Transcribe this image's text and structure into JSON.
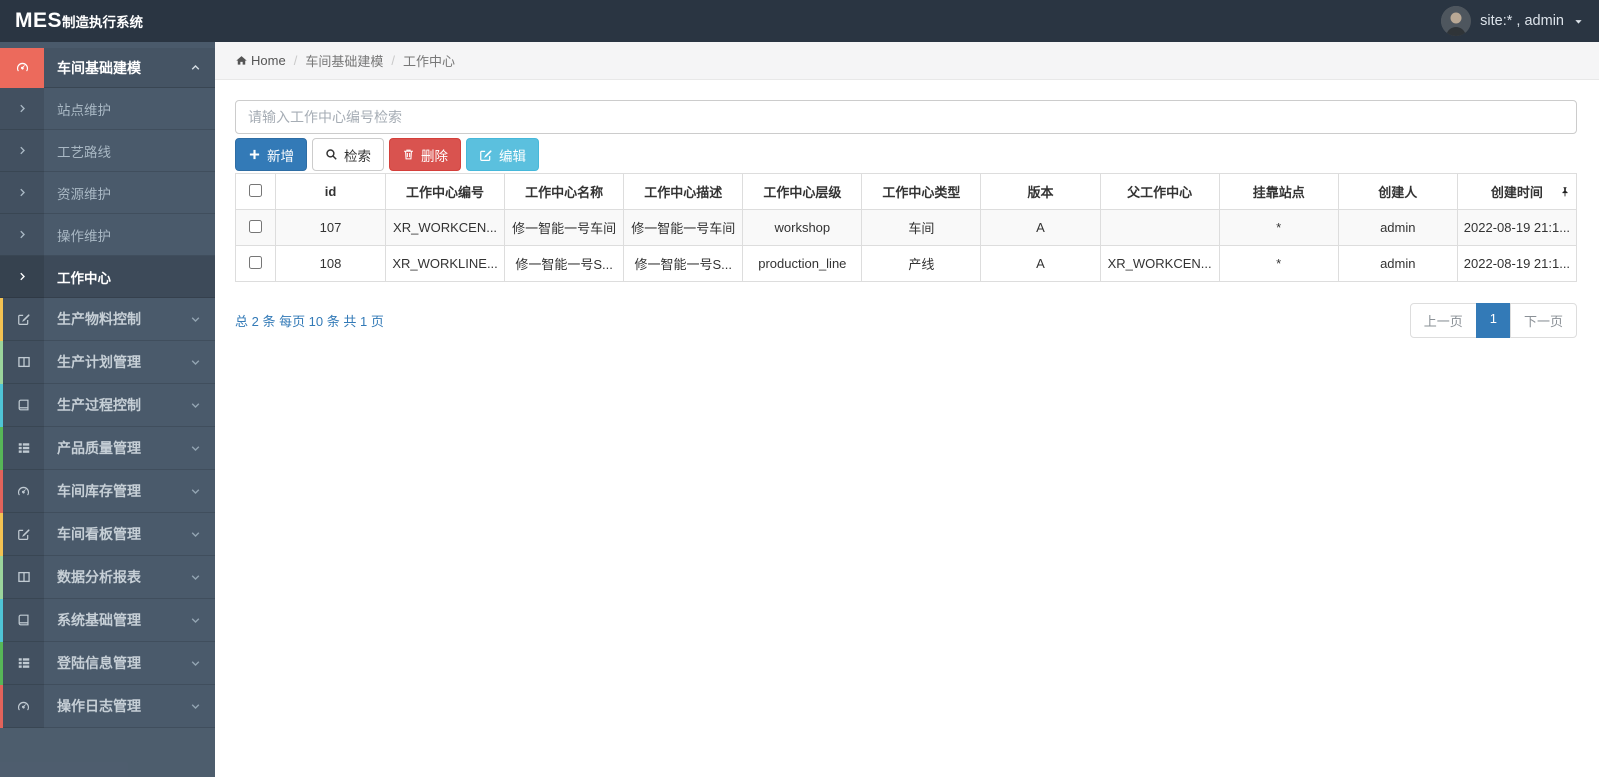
{
  "app": {
    "logo_bold": "MES",
    "logo_suffix": "制造执行系统",
    "user_label": "site:* , admin"
  },
  "breadcrumb": {
    "home": "Home",
    "items": [
      "车间基础建模",
      "工作中心"
    ]
  },
  "sidebar": {
    "active_group": {
      "label": "车间基础建模",
      "icon": "tachometer-icon",
      "accent": "#ec6a5c"
    },
    "submenu": {
      "items": [
        "站点维护",
        "工艺路线",
        "资源维护",
        "操作维护",
        "工作中心"
      ],
      "active_index": 4
    },
    "groups": [
      {
        "label": "生产物料控制",
        "icon": "edit-icon",
        "accent": "#f3c252"
      },
      {
        "label": "生产计划管理",
        "icon": "columns-icon",
        "accent": "#9bd49b"
      },
      {
        "label": "生产过程控制",
        "icon": "book-icon",
        "accent": "#4fc4d6"
      },
      {
        "label": "产品质量管理",
        "icon": "th-list-icon",
        "accent": "#57b657"
      },
      {
        "label": "车间库存管理",
        "icon": "tachometer-icon",
        "accent": "#e2635b"
      },
      {
        "label": "车间看板管理",
        "icon": "edit-icon",
        "accent": "#f3c252"
      },
      {
        "label": "数据分析报表",
        "icon": "columns-icon",
        "accent": "#9bd49b"
      },
      {
        "label": "系统基础管理",
        "icon": "book-icon",
        "accent": "#4fc4d6"
      },
      {
        "label": "登陆信息管理",
        "icon": "th-list-icon",
        "accent": "#57b657"
      },
      {
        "label": "操作日志管理",
        "icon": "tachometer-icon",
        "accent": "#e2635b"
      }
    ]
  },
  "toolbar": {
    "search_placeholder": "请输入工作中心编号检索",
    "buttons": [
      {
        "label": "新增",
        "style": "primary",
        "icon": "plus-icon"
      },
      {
        "label": "检索",
        "style": "default",
        "icon": "search-icon"
      },
      {
        "label": "删除",
        "style": "danger",
        "icon": "trash-icon"
      },
      {
        "label": "编辑",
        "style": "info",
        "icon": "edit-icon"
      }
    ]
  },
  "table": {
    "headers": [
      "id",
      "工作中心编号",
      "工作中心名称",
      "工作中心描述",
      "工作中心层级",
      "工作中心类型",
      "版本",
      "父工作中心",
      "挂靠站点",
      "创建人",
      "创建时间"
    ],
    "rows": [
      {
        "selected": false,
        "striped": true,
        "cells": [
          "107",
          "XR_WORKCEN...",
          "修一智能一号车间",
          "修一智能一号车间",
          "workshop",
          "车间",
          "A",
          "",
          "*",
          "admin",
          "2022-08-19 21:1..."
        ]
      },
      {
        "selected": false,
        "striped": false,
        "cells": [
          "108",
          "XR_WORKLINE...",
          "修一智能一号S...",
          "修一智能一号S...",
          "production_line",
          "产线",
          "A",
          "XR_WORKCEN...",
          "*",
          "admin",
          "2022-08-19 21:1..."
        ]
      }
    ]
  },
  "footer": {
    "summary": "总 2 条 每页 10 条 共 1 页",
    "pagination": {
      "prev": "上一页",
      "current": "1",
      "next": "下一页"
    }
  },
  "colors": {
    "primary": "#337ab7",
    "danger": "#d9534f",
    "info": "#5bc0de",
    "navbar_bg": "#2a3542",
    "sidebar_bg": "#4a5a6b",
    "active_group_accent": "#ec6a5c"
  }
}
